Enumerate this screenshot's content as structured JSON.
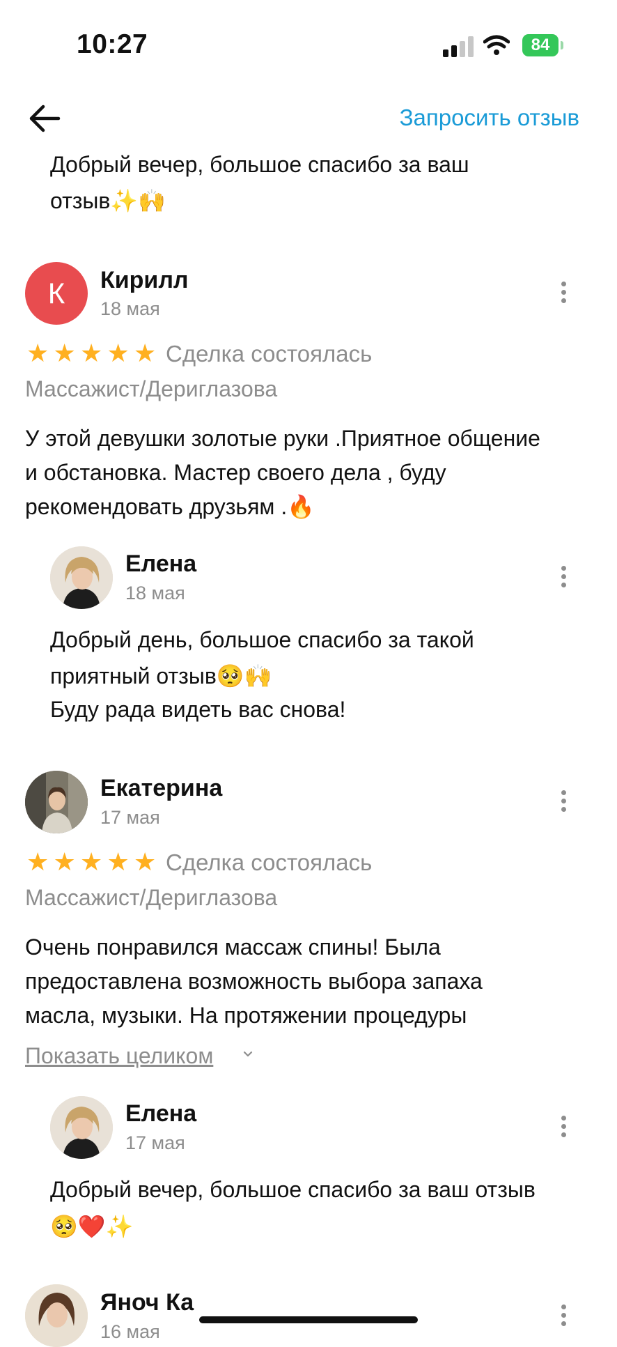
{
  "status": {
    "time": "10:27",
    "battery": "84"
  },
  "header": {
    "request_review_label": "Запросить отзыв",
    "back_icon": "arrow-left-icon"
  },
  "top_reply": {
    "text_line1": "Добрый вечер, большое спасибо за ваш",
    "text_line2": "отзыв✨🙌"
  },
  "reviews": [
    {
      "author": "Кирилл",
      "avatar_letter": "К",
      "avatar_color": "#e84c4f",
      "date": "18 мая",
      "rating": 5,
      "deal_status": "Сделка состоялась",
      "service": "Массажист/Дериглазова",
      "text_lines": [
        "У этой девушки золотые руки .Приятное общение",
        "и обстановка. Мастер своего дела , буду",
        "рекомендовать друзьям .🔥"
      ],
      "reply": {
        "author": "Елена",
        "date": "18 мая",
        "text_lines": [
          "Добрый день, большое спасибо за такой",
          "приятный отзыв🥺🙌",
          "Буду рада видеть вас снова!"
        ]
      }
    },
    {
      "author": "Екатерина",
      "date": "17 мая",
      "rating": 5,
      "deal_status": "Сделка состоялась",
      "service": "Массажист/Дериглазова",
      "text_lines": [
        "Очень понравился массаж спины! Была",
        "предоставлена возможность выбора запаха",
        "масла, музыки. На протяжении процедуры"
      ],
      "show_full_label": "Показать целиком",
      "reply": {
        "author": "Елена",
        "date": "17 мая",
        "text_lines": [
          "Добрый вечер, большое спасибо за ваш отзыв",
          "🥺❤️✨"
        ]
      }
    },
    {
      "author": "Яноч Ка",
      "date": "16 мая"
    }
  ],
  "colors": {
    "accent": "#1a9bd7",
    "star": "#ffb020",
    "muted": "#8d8d8d"
  }
}
